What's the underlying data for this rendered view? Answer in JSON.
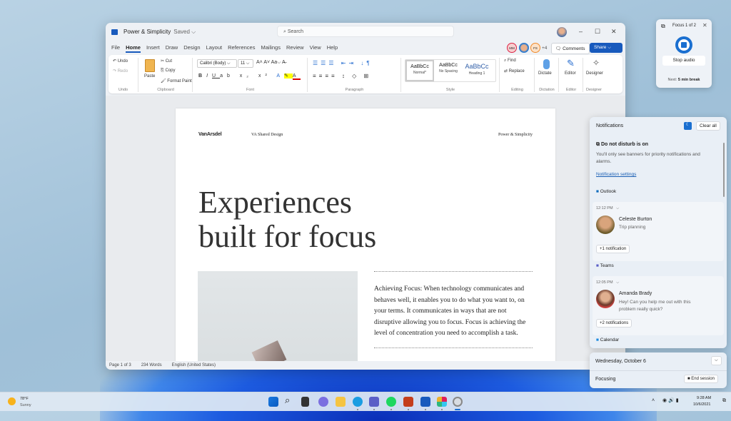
{
  "word": {
    "title": "Power & Simplicity",
    "saved": "Saved ⌵",
    "search_placeholder": "Search",
    "tabs": [
      "File",
      "Home",
      "Insert",
      "Draw",
      "Design",
      "Layout",
      "References",
      "Mailings",
      "Review",
      "View",
      "Help"
    ],
    "collaborators": [
      "MM",
      "",
      "FS"
    ],
    "more_collaborators": "+4",
    "comments": "Comments",
    "share": "Share ⌵",
    "ribbon": {
      "undo": "Undo",
      "redo": "Redo",
      "paste": "Paste",
      "cut": "Cut",
      "copy": "Copy",
      "format_paint": "Format Paint",
      "font_name": "Calibri (Body)",
      "font_size": "11",
      "styles": [
        {
          "sample": "AaBbCc",
          "name": "Normal*"
        },
        {
          "sample": "AaBbCc",
          "name": "No Spacing"
        },
        {
          "sample": "AaBbCc",
          "name": "Heading 1"
        }
      ],
      "find": "Find",
      "replace": "Replace",
      "dictate": "Dictate",
      "editor": "Editor",
      "designer": "Designer",
      "groups": [
        "Undo",
        "Clipboard",
        "Font",
        "Paragraph",
        "Style",
        "Editing",
        "Dictation",
        "Editor",
        "Designer"
      ]
    },
    "document": {
      "logo": "VanArsdel",
      "header_left": "VA Shared Design",
      "header_right": "Power & Simplicity",
      "heading_line1": "Experiences",
      "heading_line2": "built for focus",
      "body": "Achieving Focus: When technology communicates and behaves well, it enables you to do what you want to, on your terms. It communicates in ways that are not disruptive allowing you to focus. Focus is achieving the level of concentration you need to accomplish a task."
    },
    "status": {
      "page": "Page 1 of 3",
      "words": "234 Words",
      "language": "English (United States)"
    }
  },
  "focus": {
    "title": "Focus 1 of 2",
    "stop_audio": "Stop audio",
    "next_label": "Next:",
    "next_value": "5 min break"
  },
  "notifications": {
    "title": "Notifications",
    "clear_all": "Clear all",
    "dnd_title": "Do not disturb is on",
    "dnd_text": "You'll only see banners for priority notifications and alarms.",
    "settings_link": "Notification settings",
    "groups": [
      {
        "app": "Outlook",
        "time": "12:12 PM",
        "sender": "Celeste Burton",
        "message": "Trip planning",
        "more": "+1 notification"
      },
      {
        "app": "Teams",
        "time": "12:05 PM",
        "sender": "Amanda Brady",
        "message": "Hey! Can you help me out with this problem really quick?",
        "more": "+2 notifications"
      },
      {
        "app": "Calendar"
      }
    ]
  },
  "calendar": {
    "date": "Wednesday, October 6",
    "focusing": "Focusing",
    "end_session": "End session"
  },
  "taskbar": {
    "weather_temp": "78°F",
    "weather_desc": "Sunny",
    "time": "9:28 AM",
    "date": "10/6/2021",
    "colors": {
      "accent": "#185abd"
    }
  }
}
